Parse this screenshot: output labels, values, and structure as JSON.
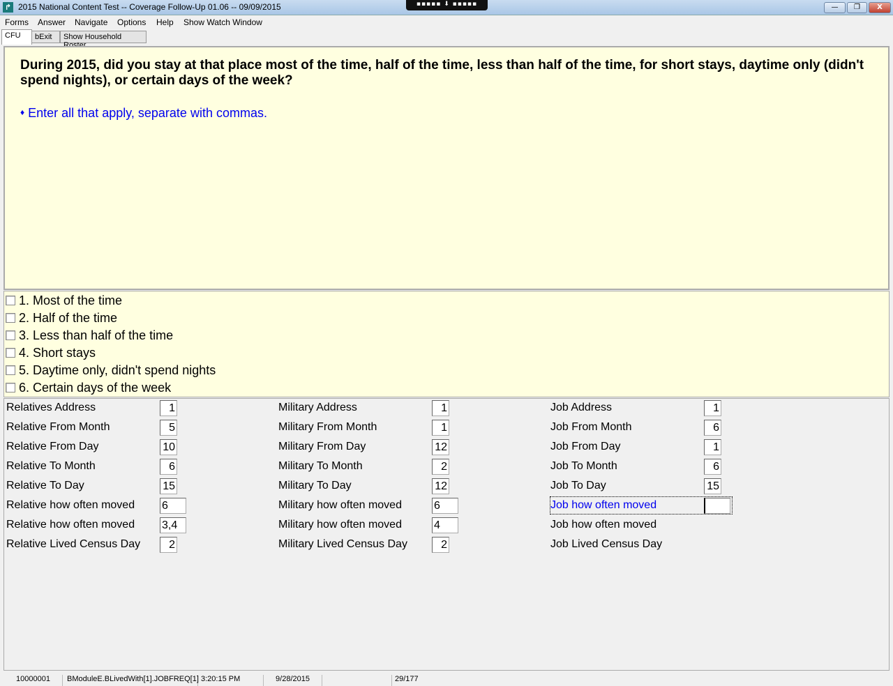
{
  "window": {
    "title": "2015 National Content Test -- Coverage Follow-Up 01.06 -- 09/09/2015",
    "minimize": "—",
    "restore": "❐",
    "close": "X",
    "dock": "▪▪▪▪▪ ⬇ ▪▪▪▪▪"
  },
  "menu": [
    "Forms",
    "Answer",
    "Navigate",
    "Options",
    "Help",
    "Show Watch Window"
  ],
  "tabs": [
    "CFU",
    "bExit",
    "Show Household Roster"
  ],
  "question": {
    "text": "During 2015, did you stay at that place most of the time, half of the time, less than half of the time, for short stays, daytime only (didn't spend nights), or certain days of the week?",
    "bullet": "♦",
    "instruction": "Enter all that apply, separate with commas."
  },
  "options": [
    "1. Most of the time",
    "2. Half of the time",
    "3. Less than half of the time",
    "4. Short stays",
    "5. Daytime only, didn't spend nights",
    "6. Certain days of the week"
  ],
  "fields": {
    "relatives": [
      {
        "label": "Relatives Address",
        "value": "1"
      },
      {
        "label": "Relative From Month",
        "value": "5"
      },
      {
        "label": "Relative From Day",
        "value": "10"
      },
      {
        "label": "Relative To Month",
        "value": "6"
      },
      {
        "label": "Relative To Day",
        "value": "15"
      },
      {
        "label": "Relative how often moved",
        "value": "6"
      },
      {
        "label": "Relative how often moved",
        "value": "3,4"
      },
      {
        "label": "Relative Lived Census Day",
        "value": "2"
      }
    ],
    "military": [
      {
        "label": "Military Address",
        "value": "1"
      },
      {
        "label": "Military From Month",
        "value": "1"
      },
      {
        "label": "Military From Day",
        "value": "12"
      },
      {
        "label": "Military To Month",
        "value": "2"
      },
      {
        "label": "Military To Day",
        "value": "12"
      },
      {
        "label": "Military how often moved",
        "value": "6"
      },
      {
        "label": "Military how often moved",
        "value": "4"
      },
      {
        "label": "Military Lived Census Day",
        "value": "2"
      }
    ],
    "job": [
      {
        "label": "Job Address",
        "value": "1"
      },
      {
        "label": "Job From Month",
        "value": "6"
      },
      {
        "label": "Job From Day",
        "value": "1"
      },
      {
        "label": "Job To Month",
        "value": "6"
      },
      {
        "label": "Job To Day",
        "value": "15"
      },
      {
        "label": "Job how often moved",
        "value": ""
      },
      {
        "label": "Job how often moved"
      },
      {
        "label": "Job Lived Census Day"
      }
    ]
  },
  "status": {
    "id": "10000001",
    "field": "BModuleE.BLivedWith[1].JOBFREQ[1]",
    "time": "3:20:15 PM",
    "date": "9/28/2015",
    "blank": "",
    "page": "29/177"
  }
}
